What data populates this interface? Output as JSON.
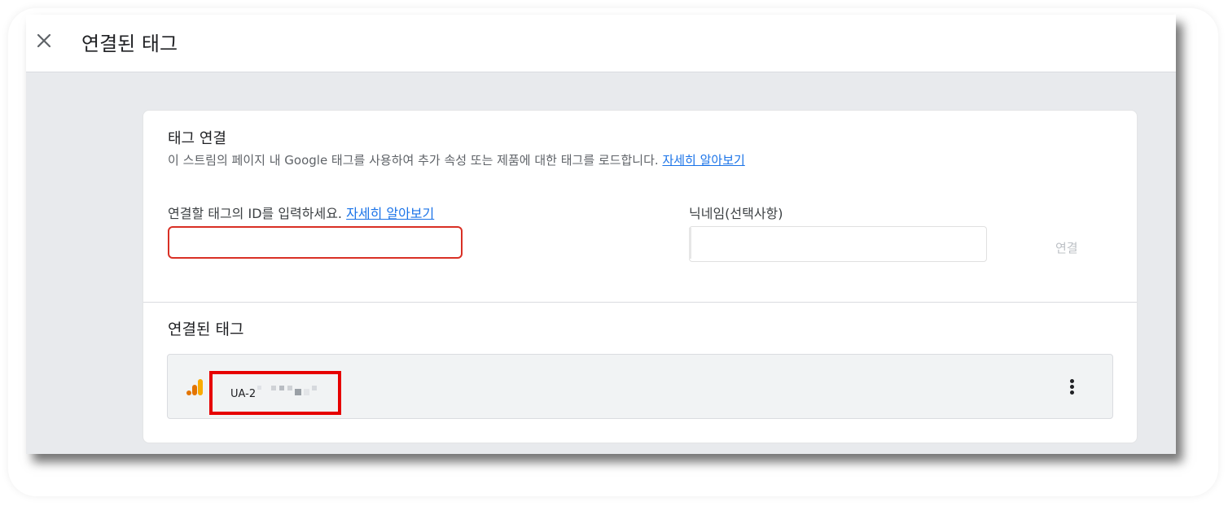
{
  "header": {
    "title": "연결된 태그",
    "close_icon": "close-icon"
  },
  "card": {
    "title": "태그 연결",
    "description": "이 스트림의 페이지 내 Google 태그를 사용하여 추가 속성 또는 제품에 대한 태그를 로드합니다.",
    "description_link": "자세히 알아보기",
    "id_field": {
      "label": "연결할 태그의 ID를 입력하세요.",
      "label_link": "자세히 알아보기",
      "value": ""
    },
    "nickname_field": {
      "label": "닉네임(선택사항)",
      "value": ""
    },
    "connect_label": "연결",
    "linked_section": {
      "heading": "연결된 태그",
      "items": [
        {
          "id": "UA-2",
          "icon": "google-analytics-icon",
          "menu_icon": "more-vert-icon"
        }
      ]
    }
  },
  "colors": {
    "accent_link": "#1a73e8",
    "error_border": "#d93025",
    "highlight_box": "#e60000",
    "analytics_orange": "#f9ab00",
    "analytics_dark_orange": "#e37400"
  }
}
